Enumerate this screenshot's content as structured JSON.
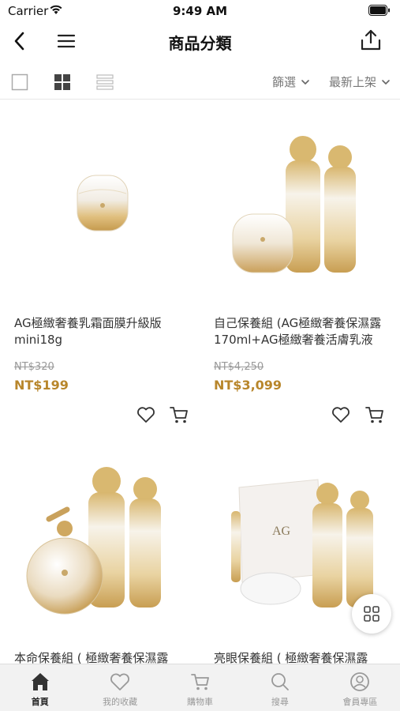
{
  "status_bar": {
    "carrier": "Carrier",
    "time": "9:49 AM"
  },
  "nav": {
    "title": "商品分類"
  },
  "toolbar": {
    "filter_label": "篩選",
    "sort_label": "最新上架"
  },
  "products": [
    {
      "name": "AG極緻奢養乳霜面膜升級版mini18g",
      "original_price": "NT$320",
      "price": "NT$199"
    },
    {
      "name": "自己保養組 (AG極緻奢養保濕露170ml+AG極緻奢養活膚乳液",
      "original_price": "NT$4,250",
      "price": "NT$3,099"
    },
    {
      "name": "本命保養組 ( 極緻奢養保濕露",
      "original_price": "",
      "price": ""
    },
    {
      "name": "亮眼保養組 ( 極緻奢養保濕露",
      "original_price": "",
      "price": ""
    }
  ],
  "tabs": [
    {
      "label": "首頁",
      "icon": "home-icon",
      "active": true
    },
    {
      "label": "我的收藏",
      "icon": "heart-icon",
      "active": false
    },
    {
      "label": "購物車",
      "icon": "cart-icon",
      "active": false
    },
    {
      "label": "搜尋",
      "icon": "search-icon",
      "active": false
    },
    {
      "label": "會員專區",
      "icon": "user-icon",
      "active": false
    }
  ],
  "colors": {
    "price": "#b8862b",
    "gold": "#d8b878",
    "inactive": "#999999"
  }
}
